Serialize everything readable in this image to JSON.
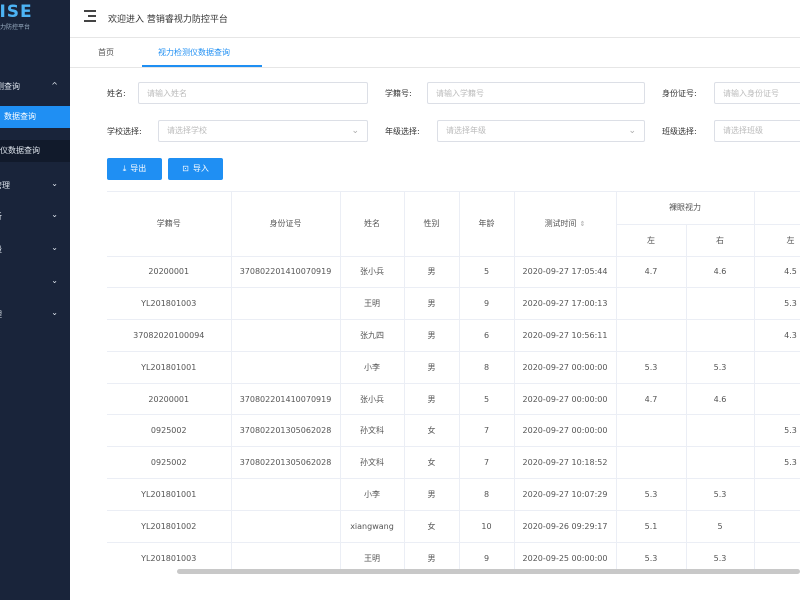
{
  "sidebar": {
    "logo_text": "CISE",
    "logo_sub": "力防控平台",
    "group_label": "测查询",
    "group_arrow": "^",
    "active_item": "数据查询",
    "sub_item": "仪数据查询",
    "items": [
      {
        "label": "管理"
      },
      {
        "label": "析"
      },
      {
        "label": "段"
      },
      {
        "label": "D"
      },
      {
        "label": "理"
      }
    ]
  },
  "header": {
    "welcome": "欢迎进入 营销睿视力防控平台"
  },
  "tabs": [
    {
      "label": "首页"
    },
    {
      "label": "视力检测仪数据查询"
    }
  ],
  "filters": {
    "name_label": "姓名:",
    "name_placeholder": "请输入姓名",
    "student_no_label": "学籍号:",
    "student_no_placeholder": "请输入学籍号",
    "id_label": "身份证号:",
    "id_placeholder": "请输入身份证号",
    "school_label": "学校选择:",
    "school_placeholder": "请选择学校",
    "grade_label": "年级选择:",
    "grade_placeholder": "请选择年级",
    "class_label": "班级选择:",
    "class_placeholder": "请选择班级"
  },
  "toolbar": {
    "export_label": "导出",
    "import_label": "导入"
  },
  "table": {
    "headers": {
      "student_no": "学籍号",
      "id_no": "身份证号",
      "name": "姓名",
      "gender": "性别",
      "age": "年龄",
      "test_time": "测试时间",
      "naked_vision": "裸眼视力",
      "left": "左",
      "right": "右",
      "left2": "左"
    },
    "rows": [
      [
        "20200001",
        "370802201410070919",
        "张小兵",
        "男",
        "5",
        "2020-09-27 17:05:44",
        "4.7",
        "4.6",
        "4.5"
      ],
      [
        "YL201801003",
        "",
        "王明",
        "男",
        "9",
        "2020-09-27 17:00:13",
        "",
        "",
        "5.3"
      ],
      [
        "37082020100094",
        "",
        "张九四",
        "男",
        "6",
        "2020-09-27 10:56:11",
        "",
        "",
        "4.3"
      ],
      [
        "YL201801001",
        "",
        "小李",
        "男",
        "8",
        "2020-09-27 00:00:00",
        "5.3",
        "5.3",
        ""
      ],
      [
        "20200001",
        "370802201410070919",
        "张小兵",
        "男",
        "5",
        "2020-09-27 00:00:00",
        "4.7",
        "4.6",
        ""
      ],
      [
        "0925002",
        "370802201305062028",
        "孙文科",
        "女",
        "7",
        "2020-09-27 00:00:00",
        "",
        "",
        "5.3"
      ],
      [
        "0925002",
        "370802201305062028",
        "孙文科",
        "女",
        "7",
        "2020-09-27 10:18:52",
        "",
        "",
        "5.3"
      ],
      [
        "YL201801001",
        "",
        "小李",
        "男",
        "8",
        "2020-09-27 10:07:29",
        "5.3",
        "5.3",
        ""
      ],
      [
        "YL201801002",
        "",
        "xiangwang",
        "女",
        "10",
        "2020-09-26 09:29:17",
        "5.1",
        "5",
        ""
      ],
      [
        "YL201801003",
        "",
        "王明",
        "男",
        "9",
        "2020-09-25 00:00:00",
        "5.3",
        "5.3",
        ""
      ]
    ]
  }
}
